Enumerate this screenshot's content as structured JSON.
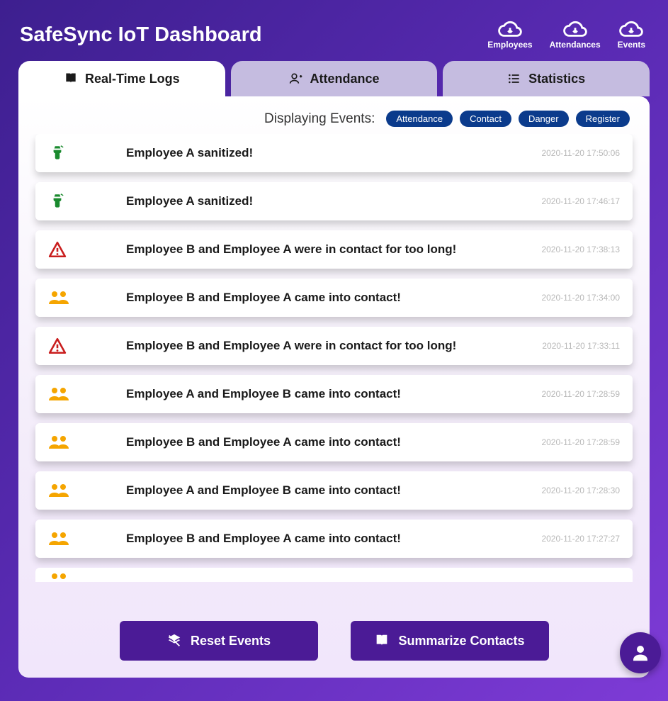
{
  "header": {
    "title": "SafeSync IoT Dashboard",
    "links": [
      {
        "label": "Employees"
      },
      {
        "label": "Attendances"
      },
      {
        "label": "Events"
      }
    ]
  },
  "tabs": [
    {
      "label": "Real-Time Logs",
      "icon": "book",
      "active": true
    },
    {
      "label": "Attendance",
      "icon": "person-add",
      "active": false
    },
    {
      "label": "Statistics",
      "icon": "list",
      "active": false
    }
  ],
  "filter": {
    "label": "Displaying Events:",
    "chips": [
      "Attendance",
      "Contact",
      "Danger",
      "Register"
    ]
  },
  "logs": [
    {
      "type": "attendance",
      "message": "Employee A sanitized!",
      "timestamp": "2020-11-20 17:50:06"
    },
    {
      "type": "attendance",
      "message": "Employee A sanitized!",
      "timestamp": "2020-11-20 17:46:17"
    },
    {
      "type": "danger",
      "message": "Employee B and Employee A were in contact for too long!",
      "timestamp": "2020-11-20 17:38:13"
    },
    {
      "type": "contact",
      "message": "Employee B and Employee A came into contact!",
      "timestamp": "2020-11-20 17:34:00"
    },
    {
      "type": "danger",
      "message": "Employee B and Employee A were in contact for too long!",
      "timestamp": "2020-11-20 17:33:11"
    },
    {
      "type": "contact",
      "message": "Employee A and Employee B came into contact!",
      "timestamp": "2020-11-20 17:28:59"
    },
    {
      "type": "contact",
      "message": "Employee B and Employee A came into contact!",
      "timestamp": "2020-11-20 17:28:59"
    },
    {
      "type": "contact",
      "message": "Employee A and Employee B came into contact!",
      "timestamp": "2020-11-20 17:28:30"
    },
    {
      "type": "contact",
      "message": "Employee B and Employee A came into contact!",
      "timestamp": "2020-11-20 17:27:27"
    },
    {
      "type": "contact",
      "message": "",
      "timestamp": ""
    }
  ],
  "actions": {
    "reset": "Reset Events",
    "summarize": "Summarize Contacts"
  },
  "colors": {
    "attendance": "#1a8a2e",
    "danger": "#c91d1d",
    "contact": "#f5a500",
    "primary": "#4b1b96",
    "chip": "#0b3b8c"
  }
}
